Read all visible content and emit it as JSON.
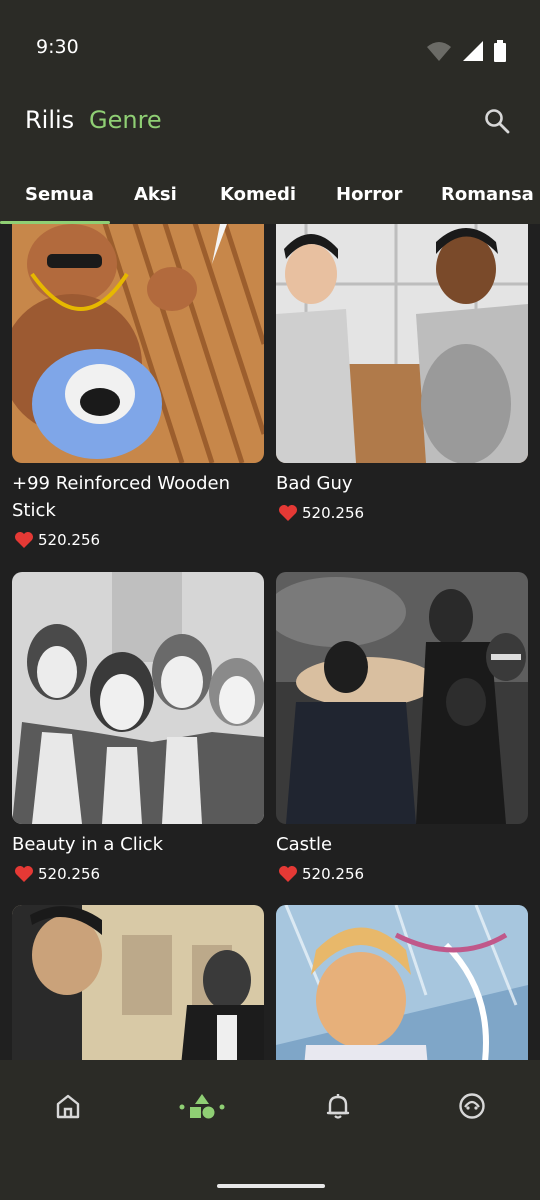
{
  "status_bar": {
    "time": "9:30",
    "icons": [
      "wifi-icon",
      "signal-icon",
      "battery-icon"
    ]
  },
  "header": {
    "title": "Rilis",
    "genre_label": "Genre",
    "search_icon": "search-icon"
  },
  "tabs": [
    {
      "label": "Semua",
      "active": true
    },
    {
      "label": "Aksi",
      "active": false
    },
    {
      "label": "Komedi",
      "active": false
    },
    {
      "label": "Horror",
      "active": false
    },
    {
      "label": "Romansa",
      "active": false
    }
  ],
  "comics": [
    {
      "title": "+99 Reinforced Wooden Stick",
      "likes": "520.256"
    },
    {
      "title": "Bad Guy",
      "likes": "520.256"
    },
    {
      "title": "Beauty in a Click",
      "likes": "520.256"
    },
    {
      "title": "Castle",
      "likes": "520.256"
    },
    {
      "title": "",
      "likes": ""
    },
    {
      "title": "",
      "likes": ""
    }
  ],
  "bottom_nav": [
    {
      "icon": "home-icon",
      "active": false
    },
    {
      "icon": "genre-shapes-icon",
      "active": true
    },
    {
      "icon": "bell-icon",
      "active": false
    },
    {
      "icon": "profile-icon",
      "active": false
    }
  ],
  "colors": {
    "accent": "#8fcf74",
    "background": "#202020",
    "bar": "#2b2b26",
    "heart": "#e53935"
  }
}
